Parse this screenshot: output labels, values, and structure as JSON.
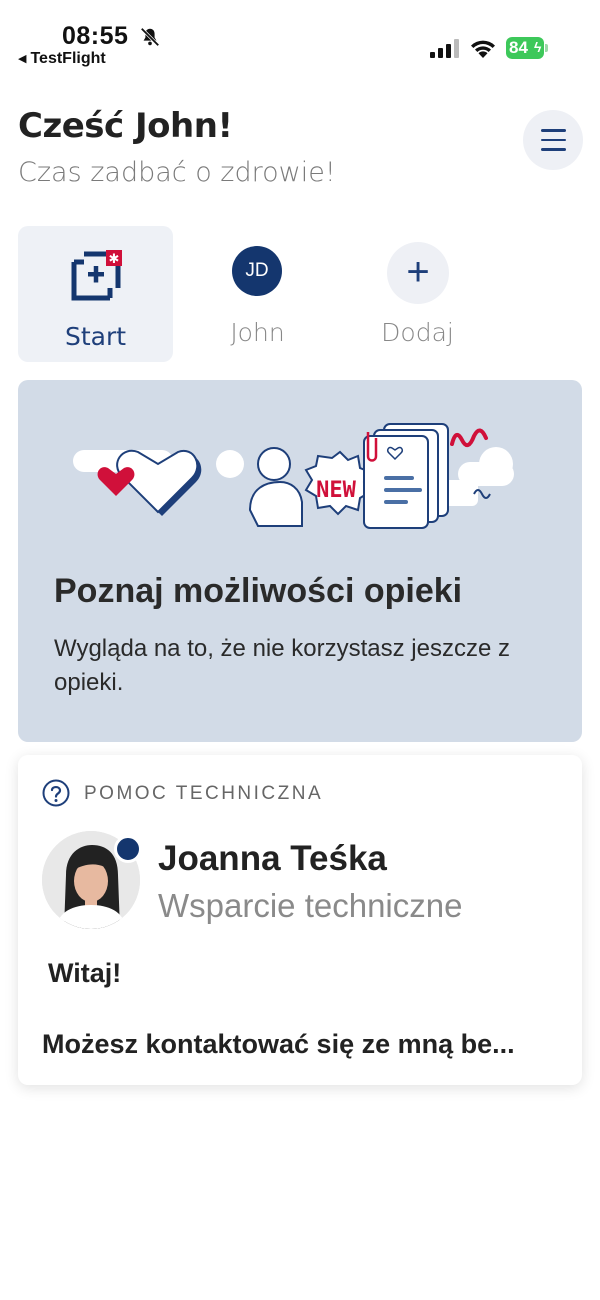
{
  "status_bar": {
    "time": "08:55",
    "back_app": "TestFlight",
    "battery": "84"
  },
  "header": {
    "greeting": "Cześć John!",
    "subtitle": "Czas zadbać o zdrowie!"
  },
  "profiles": [
    {
      "label": "Start",
      "icon": "medical-cross-icon",
      "active": true
    },
    {
      "label": "John",
      "initials": "JD",
      "active": false
    },
    {
      "label": "Dodaj",
      "icon": "plus-icon",
      "active": false
    }
  ],
  "promo": {
    "badge": "NEW",
    "title": "Poznaj możliwości opieki",
    "description": "Wygląda na to, że nie korzystasz jeszcze z opieki."
  },
  "support": {
    "section_label": "POMOC TECHNICZNA",
    "agent_name": "Joanna Teśka",
    "agent_role": "Wsparcie techniczne",
    "greeting": "Witaj!",
    "message": "Możesz kontaktować się ze mną be..."
  },
  "colors": {
    "primary": "#14366e",
    "accent_red": "#d0103a",
    "promo_bg": "#d2dbe7",
    "tab_bg": "#eef1f6",
    "battery_green": "#3dc85a"
  }
}
